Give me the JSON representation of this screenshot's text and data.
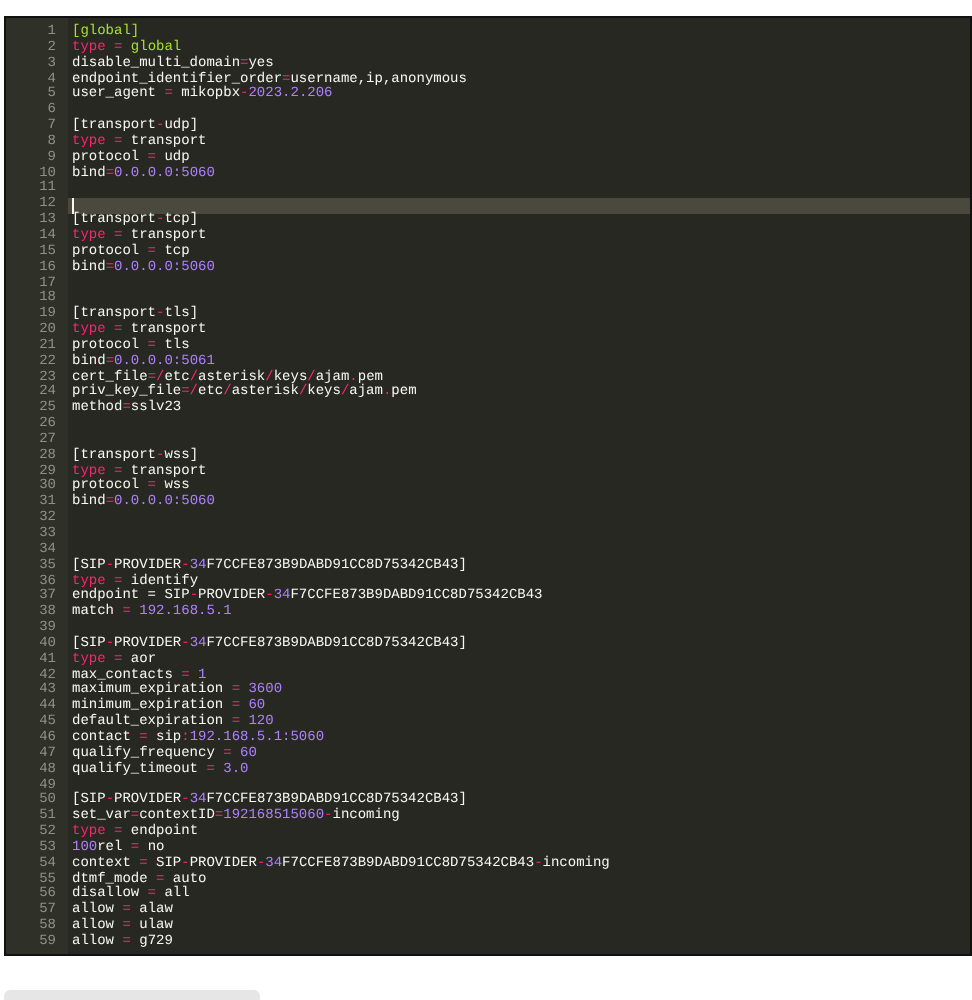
{
  "editor": {
    "lines": [
      {
        "num": "1",
        "active": false,
        "tokens": [
          {
            "kind": "green",
            "text": "[global]"
          }
        ]
      },
      {
        "num": "2",
        "active": false,
        "tokens": [
          {
            "kind": "keyword",
            "text": "type"
          },
          {
            "kind": "op",
            "text": " = "
          },
          {
            "kind": "green",
            "text": "global"
          }
        ]
      },
      {
        "num": "3",
        "active": false,
        "tokens": [
          {
            "kind": "plain",
            "text": "disable_multi_domain"
          },
          {
            "kind": "op",
            "text": "="
          },
          {
            "kind": "plain",
            "text": "yes"
          }
        ]
      },
      {
        "num": "4",
        "active": false,
        "tokens": [
          {
            "kind": "plain",
            "text": "endpoint_identifier_order"
          },
          {
            "kind": "op",
            "text": "="
          },
          {
            "kind": "plain",
            "text": "username,ip,anonymous"
          }
        ]
      },
      {
        "num": "5",
        "active": false,
        "tokens": [
          {
            "kind": "plain",
            "text": "user_agent"
          },
          {
            "kind": "op",
            "text": " = "
          },
          {
            "kind": "plain",
            "text": "mikopbx"
          },
          {
            "kind": "op",
            "text": "-"
          },
          {
            "kind": "number",
            "text": "2023.2.206"
          }
        ]
      },
      {
        "num": "6",
        "active": false
      },
      {
        "num": "7",
        "active": false,
        "tokens": [
          {
            "kind": "plain",
            "text": "[transport"
          },
          {
            "kind": "op",
            "text": "-"
          },
          {
            "kind": "plain",
            "text": "udp]"
          }
        ]
      },
      {
        "num": "8",
        "active": false,
        "tokens": [
          {
            "kind": "keyword",
            "text": "type"
          },
          {
            "kind": "op",
            "text": " = "
          },
          {
            "kind": "plain",
            "text": "transport"
          }
        ]
      },
      {
        "num": "9",
        "active": false,
        "tokens": [
          {
            "kind": "plain",
            "text": "protocol"
          },
          {
            "kind": "op",
            "text": " = "
          },
          {
            "kind": "plain",
            "text": "udp"
          }
        ]
      },
      {
        "num": "10",
        "active": false,
        "tokens": [
          {
            "kind": "plain",
            "text": "bind"
          },
          {
            "kind": "op",
            "text": "="
          },
          {
            "kind": "number",
            "text": "0.0.0.0:5060"
          }
        ]
      },
      {
        "num": "11",
        "active": false
      },
      {
        "num": "12",
        "active": true
      },
      {
        "num": "13",
        "active": false,
        "tokens": [
          {
            "kind": "plain",
            "text": "[transport"
          },
          {
            "kind": "op",
            "text": "-"
          },
          {
            "kind": "plain",
            "text": "tcp]"
          }
        ]
      },
      {
        "num": "14",
        "active": false,
        "tokens": [
          {
            "kind": "keyword",
            "text": "type"
          },
          {
            "kind": "op",
            "text": " = "
          },
          {
            "kind": "plain",
            "text": "transport"
          }
        ]
      },
      {
        "num": "15",
        "active": false,
        "tokens": [
          {
            "kind": "plain",
            "text": "protocol"
          },
          {
            "kind": "op",
            "text": " = "
          },
          {
            "kind": "plain",
            "text": "tcp"
          }
        ]
      },
      {
        "num": "16",
        "active": false,
        "tokens": [
          {
            "kind": "plain",
            "text": "bind"
          },
          {
            "kind": "op",
            "text": "="
          },
          {
            "kind": "number",
            "text": "0.0.0.0:5060"
          }
        ]
      },
      {
        "num": "17",
        "active": false
      },
      {
        "num": "18",
        "active": false
      },
      {
        "num": "19",
        "active": false,
        "tokens": [
          {
            "kind": "plain",
            "text": "[transport"
          },
          {
            "kind": "op",
            "text": "-"
          },
          {
            "kind": "plain",
            "text": "tls]"
          }
        ]
      },
      {
        "num": "20",
        "active": false,
        "tokens": [
          {
            "kind": "keyword",
            "text": "type"
          },
          {
            "kind": "op",
            "text": " = "
          },
          {
            "kind": "plain",
            "text": "transport"
          }
        ]
      },
      {
        "num": "21",
        "active": false,
        "tokens": [
          {
            "kind": "plain",
            "text": "protocol"
          },
          {
            "kind": "op",
            "text": " = "
          },
          {
            "kind": "plain",
            "text": "tls"
          }
        ]
      },
      {
        "num": "22",
        "active": false,
        "tokens": [
          {
            "kind": "plain",
            "text": "bind"
          },
          {
            "kind": "op",
            "text": "="
          },
          {
            "kind": "number",
            "text": "0.0.0.0:5061"
          }
        ]
      },
      {
        "num": "23",
        "active": false,
        "tokens": [
          {
            "kind": "plain",
            "text": "cert_file"
          },
          {
            "kind": "op",
            "text": "=/"
          },
          {
            "kind": "plain",
            "text": "etc"
          },
          {
            "kind": "op",
            "text": "/"
          },
          {
            "kind": "plain",
            "text": "asterisk"
          },
          {
            "kind": "op",
            "text": "/"
          },
          {
            "kind": "plain",
            "text": "keys"
          },
          {
            "kind": "op",
            "text": "/"
          },
          {
            "kind": "plain",
            "text": "ajam"
          },
          {
            "kind": "op",
            "text": "."
          },
          {
            "kind": "plain",
            "text": "pem"
          }
        ]
      },
      {
        "num": "24",
        "active": false,
        "tokens": [
          {
            "kind": "plain",
            "text": "priv_key_file"
          },
          {
            "kind": "op",
            "text": "=/"
          },
          {
            "kind": "plain",
            "text": "etc"
          },
          {
            "kind": "op",
            "text": "/"
          },
          {
            "kind": "plain",
            "text": "asterisk"
          },
          {
            "kind": "op",
            "text": "/"
          },
          {
            "kind": "plain",
            "text": "keys"
          },
          {
            "kind": "op",
            "text": "/"
          },
          {
            "kind": "plain",
            "text": "ajam"
          },
          {
            "kind": "op",
            "text": "."
          },
          {
            "kind": "plain",
            "text": "pem"
          }
        ]
      },
      {
        "num": "25",
        "active": false,
        "tokens": [
          {
            "kind": "plain",
            "text": "method"
          },
          {
            "kind": "op",
            "text": "="
          },
          {
            "kind": "plain",
            "text": "sslv23"
          }
        ]
      },
      {
        "num": "26",
        "active": false
      },
      {
        "num": "27",
        "active": false
      },
      {
        "num": "28",
        "active": false,
        "tokens": [
          {
            "kind": "plain",
            "text": "[transport"
          },
          {
            "kind": "op",
            "text": "-"
          },
          {
            "kind": "plain",
            "text": "wss]"
          }
        ]
      },
      {
        "num": "29",
        "active": false,
        "tokens": [
          {
            "kind": "keyword",
            "text": "type"
          },
          {
            "kind": "op",
            "text": " = "
          },
          {
            "kind": "plain",
            "text": "transport"
          }
        ]
      },
      {
        "num": "30",
        "active": false,
        "tokens": [
          {
            "kind": "plain",
            "text": "protocol"
          },
          {
            "kind": "op",
            "text": " = "
          },
          {
            "kind": "plain",
            "text": "wss"
          }
        ]
      },
      {
        "num": "31",
        "active": false,
        "tokens": [
          {
            "kind": "plain",
            "text": "bind"
          },
          {
            "kind": "op",
            "text": "="
          },
          {
            "kind": "number",
            "text": "0.0.0.0:5060"
          }
        ]
      },
      {
        "num": "32",
        "active": false
      },
      {
        "num": "33",
        "active": false
      },
      {
        "num": "34",
        "active": false
      },
      {
        "num": "35",
        "active": false,
        "tokens": [
          {
            "kind": "plain",
            "text": "[SIP"
          },
          {
            "kind": "op",
            "text": "-"
          },
          {
            "kind": "plain",
            "text": "PROVIDER"
          },
          {
            "kind": "op",
            "text": "-"
          },
          {
            "kind": "number",
            "text": "34"
          },
          {
            "kind": "plain",
            "text": "F7CCFE873B9DABD91CC8D75342CB43]"
          }
        ]
      },
      {
        "num": "36",
        "active": false,
        "tokens": [
          {
            "kind": "keyword",
            "text": "type"
          },
          {
            "kind": "op",
            "text": " = "
          },
          {
            "kind": "plain",
            "text": "identify"
          }
        ]
      },
      {
        "num": "37",
        "active": false,
        "tokens": [
          {
            "kind": "plain",
            "text": "endpoint = SIP"
          },
          {
            "kind": "op",
            "text": "-"
          },
          {
            "kind": "plain",
            "text": "PROVIDER"
          },
          {
            "kind": "op",
            "text": "-"
          },
          {
            "kind": "number",
            "text": "34"
          },
          {
            "kind": "plain",
            "text": "F7CCFE873B9DABD91CC8D75342CB43"
          }
        ]
      },
      {
        "num": "38",
        "active": false,
        "tokens": [
          {
            "kind": "plain",
            "text": "match"
          },
          {
            "kind": "op",
            "text": " = "
          },
          {
            "kind": "number",
            "text": "192.168.5.1"
          }
        ]
      },
      {
        "num": "39",
        "active": false
      },
      {
        "num": "40",
        "active": false,
        "tokens": [
          {
            "kind": "plain",
            "text": "[SIP"
          },
          {
            "kind": "op",
            "text": "-"
          },
          {
            "kind": "plain",
            "text": "PROVIDER"
          },
          {
            "kind": "op",
            "text": "-"
          },
          {
            "kind": "number",
            "text": "34"
          },
          {
            "kind": "plain",
            "text": "F7CCFE873B9DABD91CC8D75342CB43]"
          }
        ]
      },
      {
        "num": "41",
        "active": false,
        "tokens": [
          {
            "kind": "keyword",
            "text": "type"
          },
          {
            "kind": "op",
            "text": " = "
          },
          {
            "kind": "plain",
            "text": "aor"
          }
        ]
      },
      {
        "num": "42",
        "active": false,
        "tokens": [
          {
            "kind": "plain",
            "text": "max_contacts"
          },
          {
            "kind": "op",
            "text": " = "
          },
          {
            "kind": "number",
            "text": "1"
          }
        ]
      },
      {
        "num": "43",
        "active": false,
        "tokens": [
          {
            "kind": "plain",
            "text": "maximum_expiration"
          },
          {
            "kind": "op",
            "text": " = "
          },
          {
            "kind": "number",
            "text": "3600"
          }
        ]
      },
      {
        "num": "44",
        "active": false,
        "tokens": [
          {
            "kind": "plain",
            "text": "minimum_expiration"
          },
          {
            "kind": "op",
            "text": " = "
          },
          {
            "kind": "number",
            "text": "60"
          }
        ]
      },
      {
        "num": "45",
        "active": false,
        "tokens": [
          {
            "kind": "plain",
            "text": "default_expiration"
          },
          {
            "kind": "op",
            "text": " = "
          },
          {
            "kind": "number",
            "text": "120"
          }
        ]
      },
      {
        "num": "46",
        "active": false,
        "tokens": [
          {
            "kind": "plain",
            "text": "contact"
          },
          {
            "kind": "op",
            "text": " = "
          },
          {
            "kind": "plain",
            "text": "sip"
          },
          {
            "kind": "op",
            "text": ":"
          },
          {
            "kind": "number",
            "text": "192.168.5.1:5060"
          }
        ]
      },
      {
        "num": "47",
        "active": false,
        "tokens": [
          {
            "kind": "plain",
            "text": "qualify_frequency"
          },
          {
            "kind": "op",
            "text": " = "
          },
          {
            "kind": "number",
            "text": "60"
          }
        ]
      },
      {
        "num": "48",
        "active": false,
        "tokens": [
          {
            "kind": "plain",
            "text": "qualify_timeout"
          },
          {
            "kind": "op",
            "text": " = "
          },
          {
            "kind": "number",
            "text": "3.0"
          }
        ]
      },
      {
        "num": "49",
        "active": false
      },
      {
        "num": "50",
        "active": false,
        "tokens": [
          {
            "kind": "plain",
            "text": "[SIP"
          },
          {
            "kind": "op",
            "text": "-"
          },
          {
            "kind": "plain",
            "text": "PROVIDER"
          },
          {
            "kind": "op",
            "text": "-"
          },
          {
            "kind": "number",
            "text": "34"
          },
          {
            "kind": "plain",
            "text": "F7CCFE873B9DABD91CC8D75342CB43]"
          }
        ]
      },
      {
        "num": "51",
        "active": false,
        "tokens": [
          {
            "kind": "plain",
            "text": "set_var"
          },
          {
            "kind": "op",
            "text": "="
          },
          {
            "kind": "plain",
            "text": "contextID"
          },
          {
            "kind": "op",
            "text": "="
          },
          {
            "kind": "number",
            "text": "192168515060"
          },
          {
            "kind": "op",
            "text": "-"
          },
          {
            "kind": "plain",
            "text": "incoming"
          }
        ]
      },
      {
        "num": "52",
        "active": false,
        "tokens": [
          {
            "kind": "keyword",
            "text": "type"
          },
          {
            "kind": "op",
            "text": " = "
          },
          {
            "kind": "plain",
            "text": "endpoint"
          }
        ]
      },
      {
        "num": "53",
        "active": false,
        "tokens": [
          {
            "kind": "number",
            "text": "100"
          },
          {
            "kind": "plain",
            "text": "rel"
          },
          {
            "kind": "op",
            "text": " = "
          },
          {
            "kind": "plain",
            "text": "no"
          }
        ]
      },
      {
        "num": "54",
        "active": false,
        "tokens": [
          {
            "kind": "plain",
            "text": "context"
          },
          {
            "kind": "op",
            "text": " = "
          },
          {
            "kind": "plain",
            "text": "SIP"
          },
          {
            "kind": "op",
            "text": "-"
          },
          {
            "kind": "plain",
            "text": "PROVIDER"
          },
          {
            "kind": "op",
            "text": "-"
          },
          {
            "kind": "number",
            "text": "34"
          },
          {
            "kind": "plain",
            "text": "F7CCFE873B9DABD91CC8D75342CB43"
          },
          {
            "kind": "op",
            "text": "-"
          },
          {
            "kind": "plain",
            "text": "incoming"
          }
        ]
      },
      {
        "num": "55",
        "active": false,
        "tokens": [
          {
            "kind": "plain",
            "text": "dtmf_mode"
          },
          {
            "kind": "op",
            "text": " = "
          },
          {
            "kind": "plain",
            "text": "auto"
          }
        ]
      },
      {
        "num": "56",
        "active": false,
        "tokens": [
          {
            "kind": "plain",
            "text": "disallow"
          },
          {
            "kind": "op",
            "text": " = "
          },
          {
            "kind": "plain",
            "text": "all"
          }
        ]
      },
      {
        "num": "57",
        "active": false,
        "tokens": [
          {
            "kind": "plain",
            "text": "allow"
          },
          {
            "kind": "op",
            "text": " = "
          },
          {
            "kind": "plain",
            "text": "alaw"
          }
        ]
      },
      {
        "num": "58",
        "active": false,
        "tokens": [
          {
            "kind": "plain",
            "text": "allow"
          },
          {
            "kind": "op",
            "text": " = "
          },
          {
            "kind": "plain",
            "text": "ulaw"
          }
        ]
      },
      {
        "num": "59",
        "active": false,
        "tokens": [
          {
            "kind": "plain",
            "text": "allow"
          },
          {
            "kind": "op",
            "text": " = "
          },
          {
            "kind": "plain",
            "text": "g729"
          }
        ]
      }
    ]
  }
}
